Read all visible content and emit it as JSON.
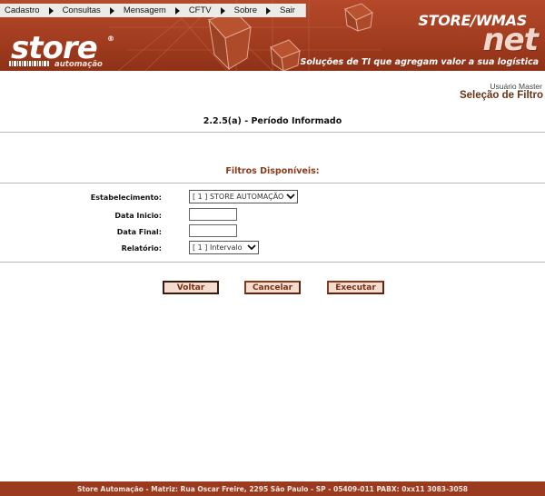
{
  "menu": {
    "items": [
      {
        "label": "Cadastro"
      },
      {
        "label": "Consultas"
      },
      {
        "label": "Mensagem"
      },
      {
        "label": "CFTV"
      },
      {
        "label": "Sobre"
      },
      {
        "label": "Sair"
      }
    ]
  },
  "header": {
    "logo_text": "store",
    "logo_registered": "®",
    "logo_sub": "automação",
    "brand": "STORE/WMAS",
    "brand_suffix": "net",
    "slogan": "Soluções de TI que agregam valor a sua logística"
  },
  "user": {
    "name": "Usuário Master",
    "section": "Seleção de Filtro"
  },
  "page": {
    "title": "2.2.5(a) - Período Informado",
    "filters_title": "Filtros Disponíveis:"
  },
  "form": {
    "establishment": {
      "label": "Estabelecimento:",
      "value": "[ 1 ] STORE AUTOMAÇÃO"
    },
    "start_date": {
      "label": "Data Inicio:",
      "value": ""
    },
    "end_date": {
      "label": "Data Final:",
      "value": ""
    },
    "report": {
      "label": "Relatório:",
      "value": "[ 1 ] Intervalo"
    }
  },
  "buttons": {
    "back": "Voltar",
    "cancel": "Cancelar",
    "execute": "Executar"
  },
  "footer": {
    "text": "Store Automação - Matriz: Rua Oscar Freire, 2295 São Paulo - SP - 05409-011 PABX: 0xx11 3083-3058"
  },
  "colors": {
    "banner": "#a33d20",
    "accent_text": "#8b3b1a",
    "button_fill": "#f3ddd0",
    "footer": "#9a3a1e"
  }
}
